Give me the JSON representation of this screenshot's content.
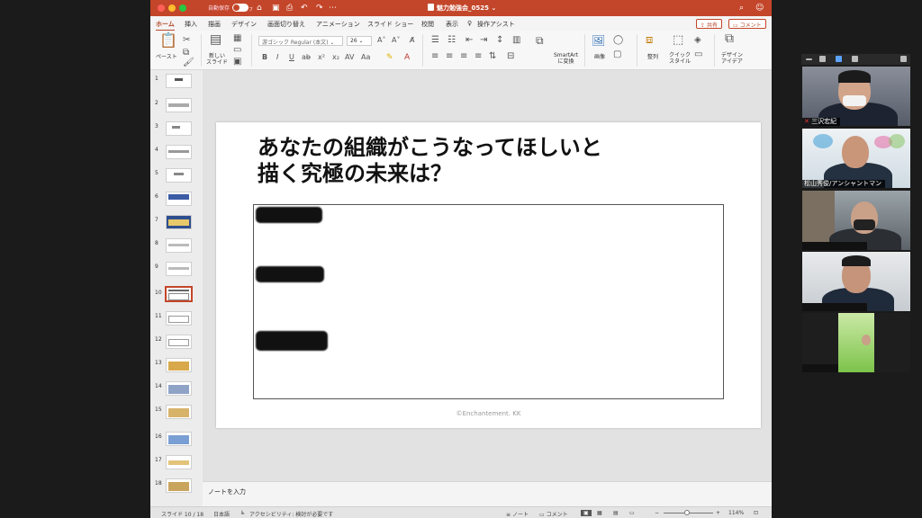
{
  "window": {
    "autosave_label": "自動保存",
    "autosave_state": "オフ",
    "document_title": "魅力勉強会_0525",
    "accent_color": "#c4462a"
  },
  "tabs": [
    "ホーム",
    "挿入",
    "描画",
    "デザイン",
    "画面切り替え",
    "アニメーション",
    "スライド ショー",
    "校閲",
    "表示"
  ],
  "assist_label": "操作アシスト",
  "share_label": "共有",
  "comment_label": "コメント",
  "ribbon": {
    "paste_label": "ペースト",
    "new_slide_label": "新しい\nスライド",
    "font_name": "游ゴシック Regular (本文)",
    "font_size": "26",
    "smartart_label": "SmartArt\nに変換",
    "image_label": "画像",
    "arrange_label": "整列",
    "quick_style_label": "クイック\nスタイル",
    "design_ideas_label": "デザイン\nアイデア"
  },
  "thumbnails": [
    "1",
    "2",
    "3",
    "4",
    "5",
    "6",
    "7",
    "8",
    "9",
    "10",
    "11",
    "12",
    "13",
    "14",
    "15",
    "16",
    "17",
    "18"
  ],
  "selected_slide": 10,
  "slide": {
    "title_line1": "あなたの組織がこうなってほしいと",
    "title_line2": "描く究極の未来は？",
    "copyright": "©Enchantement. KK"
  },
  "notes_placeholder": "ノートを入力",
  "status": {
    "slide_counter": "スライド 10 / 18",
    "language": "日本語",
    "accessibility": "アクセシビリティ: 検討が必要です",
    "notes_btn": "ノート",
    "comments_btn": "コメント",
    "zoom": "114%"
  },
  "participants": [
    {
      "name": "三沢宏紀"
    },
    {
      "name": "松山秀俊/アンシャントマン"
    },
    {
      "name": ""
    },
    {
      "name": ""
    },
    {
      "name": ""
    }
  ]
}
